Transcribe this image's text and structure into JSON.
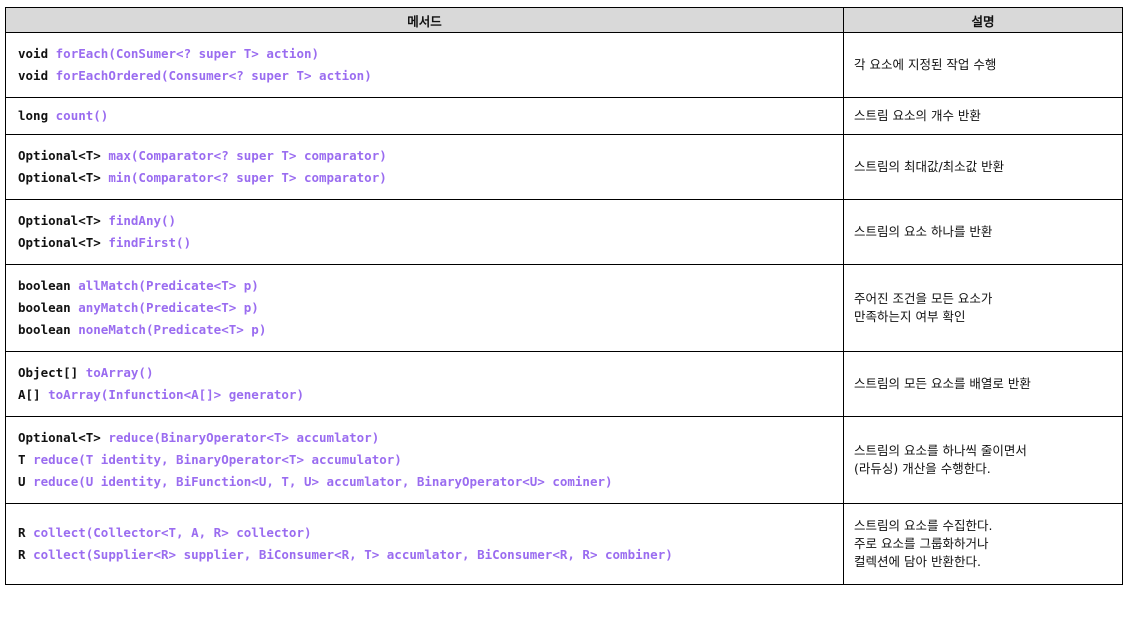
{
  "header": {
    "method": "메서드",
    "description": "설명"
  },
  "accent_color": "#9a6cf0",
  "rows": [
    {
      "methods": [
        {
          "ret": "void ",
          "name": "forEach(ConSumer<? super T> action)"
        },
        {
          "ret": "void ",
          "name": "forEachOrdered(Consumer<? super T> action)"
        }
      ],
      "description": [
        "각 요소에 지정된 작업 수행"
      ]
    },
    {
      "methods": [
        {
          "ret": "long ",
          "name": "count()"
        }
      ],
      "description": [
        "스트림 요소의 개수 반환"
      ]
    },
    {
      "methods": [
        {
          "ret": "Optional<T> ",
          "name": "max(Comparator<? super T> comparator)"
        },
        {
          "ret": "Optional<T> ",
          "name": "min(Comparator<? super T> comparator)"
        }
      ],
      "description": [
        "스트림의 최대값/최소값 반환"
      ]
    },
    {
      "methods": [
        {
          "ret": "Optional<T> ",
          "name": "findAny()"
        },
        {
          "ret": "Optional<T> ",
          "name": "findFirst()"
        }
      ],
      "description": [
        "스트림의 요소 하나를 반환"
      ]
    },
    {
      "methods": [
        {
          "ret": "boolean ",
          "name": "allMatch(Predicate<T> p)"
        },
        {
          "ret": "boolean ",
          "name": "anyMatch(Predicate<T> p)"
        },
        {
          "ret": "boolean ",
          "name": "noneMatch(Predicate<T> p)"
        }
      ],
      "description": [
        "주어진 조건을 모든 요소가",
        "만족하는지 여부 확인"
      ]
    },
    {
      "methods": [
        {
          "ret": "Object[] ",
          "name": "toArray()"
        },
        {
          "ret": "A[] ",
          "name": "toArray(Infunction<A[]> generator)"
        }
      ],
      "description": [
        "스트림의 모든 요소를 배열로 반환"
      ]
    },
    {
      "methods": [
        {
          "ret": "Optional<T> ",
          "name": "reduce(BinaryOperator<T> accumlator)"
        },
        {
          "ret": "T ",
          "name": "reduce(T identity, BinaryOperator<T> accumulator)"
        },
        {
          "ret": "U ",
          "name": "reduce(U identity, BiFunction<U, T, U> accumlator, BinaryOperator<U> cominer)"
        }
      ],
      "description": [
        "스트림의 요소를 하나씩 줄이면서",
        "(라듀싱) 개산을 수행한다."
      ]
    },
    {
      "methods": [
        {
          "ret": "R ",
          "name": "collect(Collector<T, A, R> collector)"
        },
        {
          "ret": "R ",
          "name": "collect(Supplier<R> supplier, BiConsumer<R, T> accumlator, BiConsumer<R, R> combiner)"
        }
      ],
      "description": [
        "스트림의 요소를 수집한다.",
        "주로 요소를 그룹화하거나",
        "컬렉션에 담아 반환한다."
      ]
    }
  ]
}
